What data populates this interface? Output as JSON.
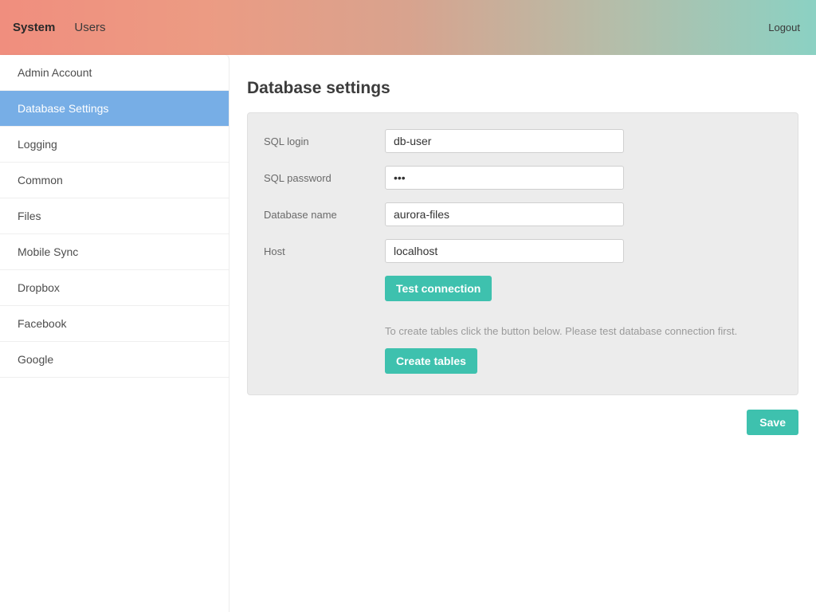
{
  "header": {
    "nav": [
      {
        "label": "System",
        "active": true
      },
      {
        "label": "Users",
        "active": false
      }
    ],
    "logout": "Logout"
  },
  "sidebar": {
    "items": [
      {
        "label": "Admin Account",
        "active": false
      },
      {
        "label": "Database Settings",
        "active": true
      },
      {
        "label": "Logging",
        "active": false
      },
      {
        "label": "Common",
        "active": false
      },
      {
        "label": "Files",
        "active": false
      },
      {
        "label": "Mobile Sync",
        "active": false
      },
      {
        "label": "Dropbox",
        "active": false
      },
      {
        "label": "Facebook",
        "active": false
      },
      {
        "label": "Google",
        "active": false
      }
    ]
  },
  "main": {
    "title": "Database settings",
    "fields": {
      "sql_login": {
        "label": "SQL login",
        "value": "db-user"
      },
      "sql_password": {
        "label": "SQL password",
        "value": "•••"
      },
      "db_name": {
        "label": "Database name",
        "value": "aurora-files"
      },
      "host": {
        "label": "Host",
        "value": "localhost"
      }
    },
    "buttons": {
      "test": "Test connection",
      "create": "Create tables",
      "save": "Save"
    },
    "hint": "To create tables click the button below. Please test database connection first."
  }
}
